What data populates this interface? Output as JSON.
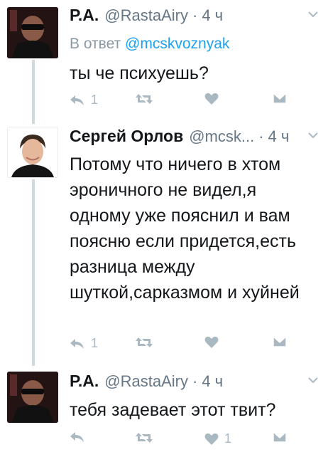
{
  "tweets": [
    {
      "name": "Р.А.",
      "handle": "@RastaAiry",
      "sep": "·",
      "time": "4 ч",
      "reply_prefix": "В ответ",
      "reply_mention": "@mcskvoznyak",
      "text": "ты че психуешь?",
      "reply_count": "1",
      "retweet_count": "",
      "like_count": "",
      "avatar_icon": "user-photo-dark"
    },
    {
      "name": "Сергей Орлов",
      "handle": "@mcsk...",
      "sep": "·",
      "time": "4 ч",
      "text": "Потому что ничего в хтом эроничного не видел,я одному уже пояснил и вам поясню если придется,есть разница между шуткой,сарказмом и хуйней",
      "reply_count": "1",
      "retweet_count": "",
      "like_count": "",
      "avatar_icon": "user-photo-light"
    },
    {
      "name": "Р.А.",
      "handle": "@RastaAiry",
      "sep": "·",
      "time": "4 ч",
      "text": "тебя задевает этот твит?",
      "reply_count": "",
      "retweet_count": "",
      "like_count": "1",
      "avatar_icon": "user-photo-dark"
    }
  ],
  "colors": {
    "text": "#14171a",
    "secondary": "#657786",
    "link": "#1da1f2",
    "icon": "#aab8c2",
    "thread_line": "#cfd9de"
  },
  "icons": [
    "reply-icon",
    "retweet-icon",
    "like-icon",
    "dm-icon",
    "chevron-down-icon"
  ]
}
